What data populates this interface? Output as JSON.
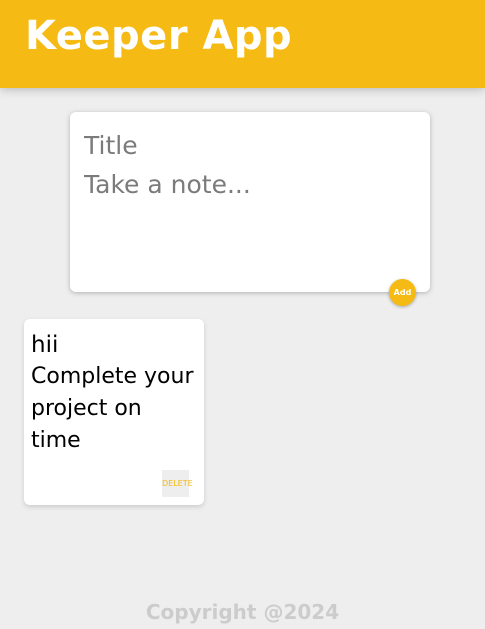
{
  "header": {
    "title": "Keeper App"
  },
  "create_area": {
    "title_placeholder": "Title",
    "content_placeholder": "Take a note...",
    "add_label": "Add"
  },
  "notes": [
    {
      "title": "hii",
      "content": "Complete your project on time",
      "delete_label": "DELETE"
    }
  ],
  "footer": {
    "copyright": "Copyright @2024"
  },
  "colors": {
    "accent": "#f5ba13",
    "background": "#eeeeee",
    "footer_text": "#cccccc"
  }
}
